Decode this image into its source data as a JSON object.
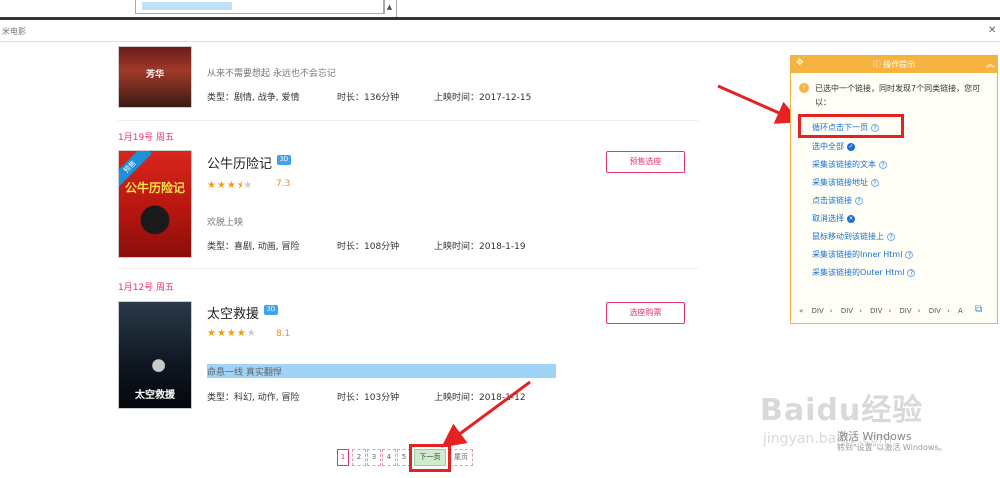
{
  "url_bar": {
    "text": "米电影"
  },
  "films": [
    {
      "tagline": "从来不需要想起 永远也不会忘记",
      "poster_text": "芳华",
      "type": "类型：剧情, 战争, 爱情",
      "duration": "时长：136分钟",
      "release": "上映时间：2017-12-15"
    },
    {
      "date": "1月19号 周五",
      "title": "公牛历险记",
      "badge": "3D",
      "rating": 3.5,
      "score": "7.3",
      "tagline": "欢脱上映",
      "poster_text": "公牛历险记",
      "poster_ribbon": "预售",
      "type": "类型：喜剧, 动画, 冒险",
      "duration": "时长：108分钟",
      "release": "上映时间：2018-1-19",
      "button": "预售选座"
    },
    {
      "date": "1月12号 周五",
      "title": "太空救援",
      "badge": "3D",
      "rating": 4,
      "score": "8.1",
      "tagline": "命悬一线 真实翻悍",
      "poster_text": "太空救援",
      "type": "类型：科幻, 动作, 冒险",
      "duration": "时长：103分钟",
      "release": "上映时间：2018-1-12",
      "button": "选座购票"
    }
  ],
  "pagination": {
    "pages": [
      "1",
      "2",
      "3",
      "4",
      "5"
    ],
    "next": "下一页",
    "last": "尾页"
  },
  "panel": {
    "title": "操作提示",
    "message": "已选中一个链接，同时发现7个同类链接，您可以：",
    "actions": [
      "循环点击下一页",
      "选中全部",
      "采集该链接的文本",
      "采集该链接地址",
      "点击该链接",
      "取消选择",
      "鼠标移动到该链接上",
      "采集该链接的Inner Html",
      "采集该链接的Outer Html"
    ],
    "path": [
      "DIV",
      "DIV",
      "DIV",
      "DIV",
      "DIV",
      "A"
    ]
  },
  "watermark": {
    "logo": "Baidu经验",
    "url": "jingyan.baidu.com",
    "activate_title": "激活 Windows",
    "activate_sub": "转到\"设置\"以激活 Windows。"
  },
  "colors": {
    "accent_pink": "#e5336e",
    "panel_orange": "#f6b341",
    "link_blue": "#1a6fd0",
    "annotation_red": "#e52222"
  }
}
